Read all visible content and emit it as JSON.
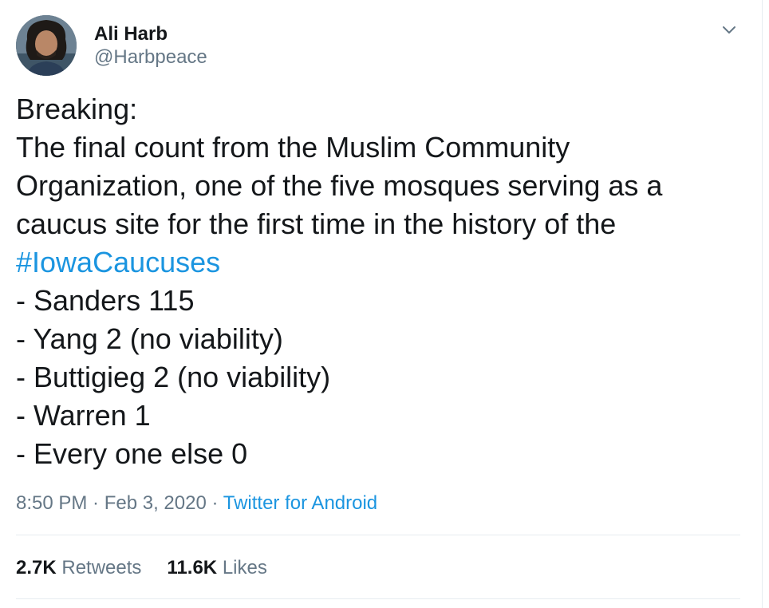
{
  "author": {
    "name": "Ali Harb",
    "handle": "@Harbpeace"
  },
  "tweet": {
    "lines": [
      "Breaking:",
      "The final count from the Muslim Community",
      "Organization, one of the five mosques serving as a",
      "caucus site for the first time in the history of the"
    ],
    "hashtag": "#IowaCaucuses",
    "results": [
      "- Sanders 115",
      "- Yang 2 (no viability)",
      "- Buttigieg 2 (no viability)",
      "- Warren 1",
      "- Every one else 0"
    ]
  },
  "meta": {
    "time": "8:50 PM",
    "separator": " · ",
    "date": "Feb 3, 2020",
    "source": "Twitter for Android"
  },
  "stats": {
    "retweets_count": "2.7K",
    "retweets_label": "Retweets",
    "likes_count": "11.6K",
    "likes_label": "Likes"
  },
  "icons": {
    "caret": "chevron-down-icon"
  },
  "colors": {
    "text": "#14171a",
    "secondary": "#657786",
    "link": "#1b95e0",
    "divider": "#e6ecf0"
  }
}
